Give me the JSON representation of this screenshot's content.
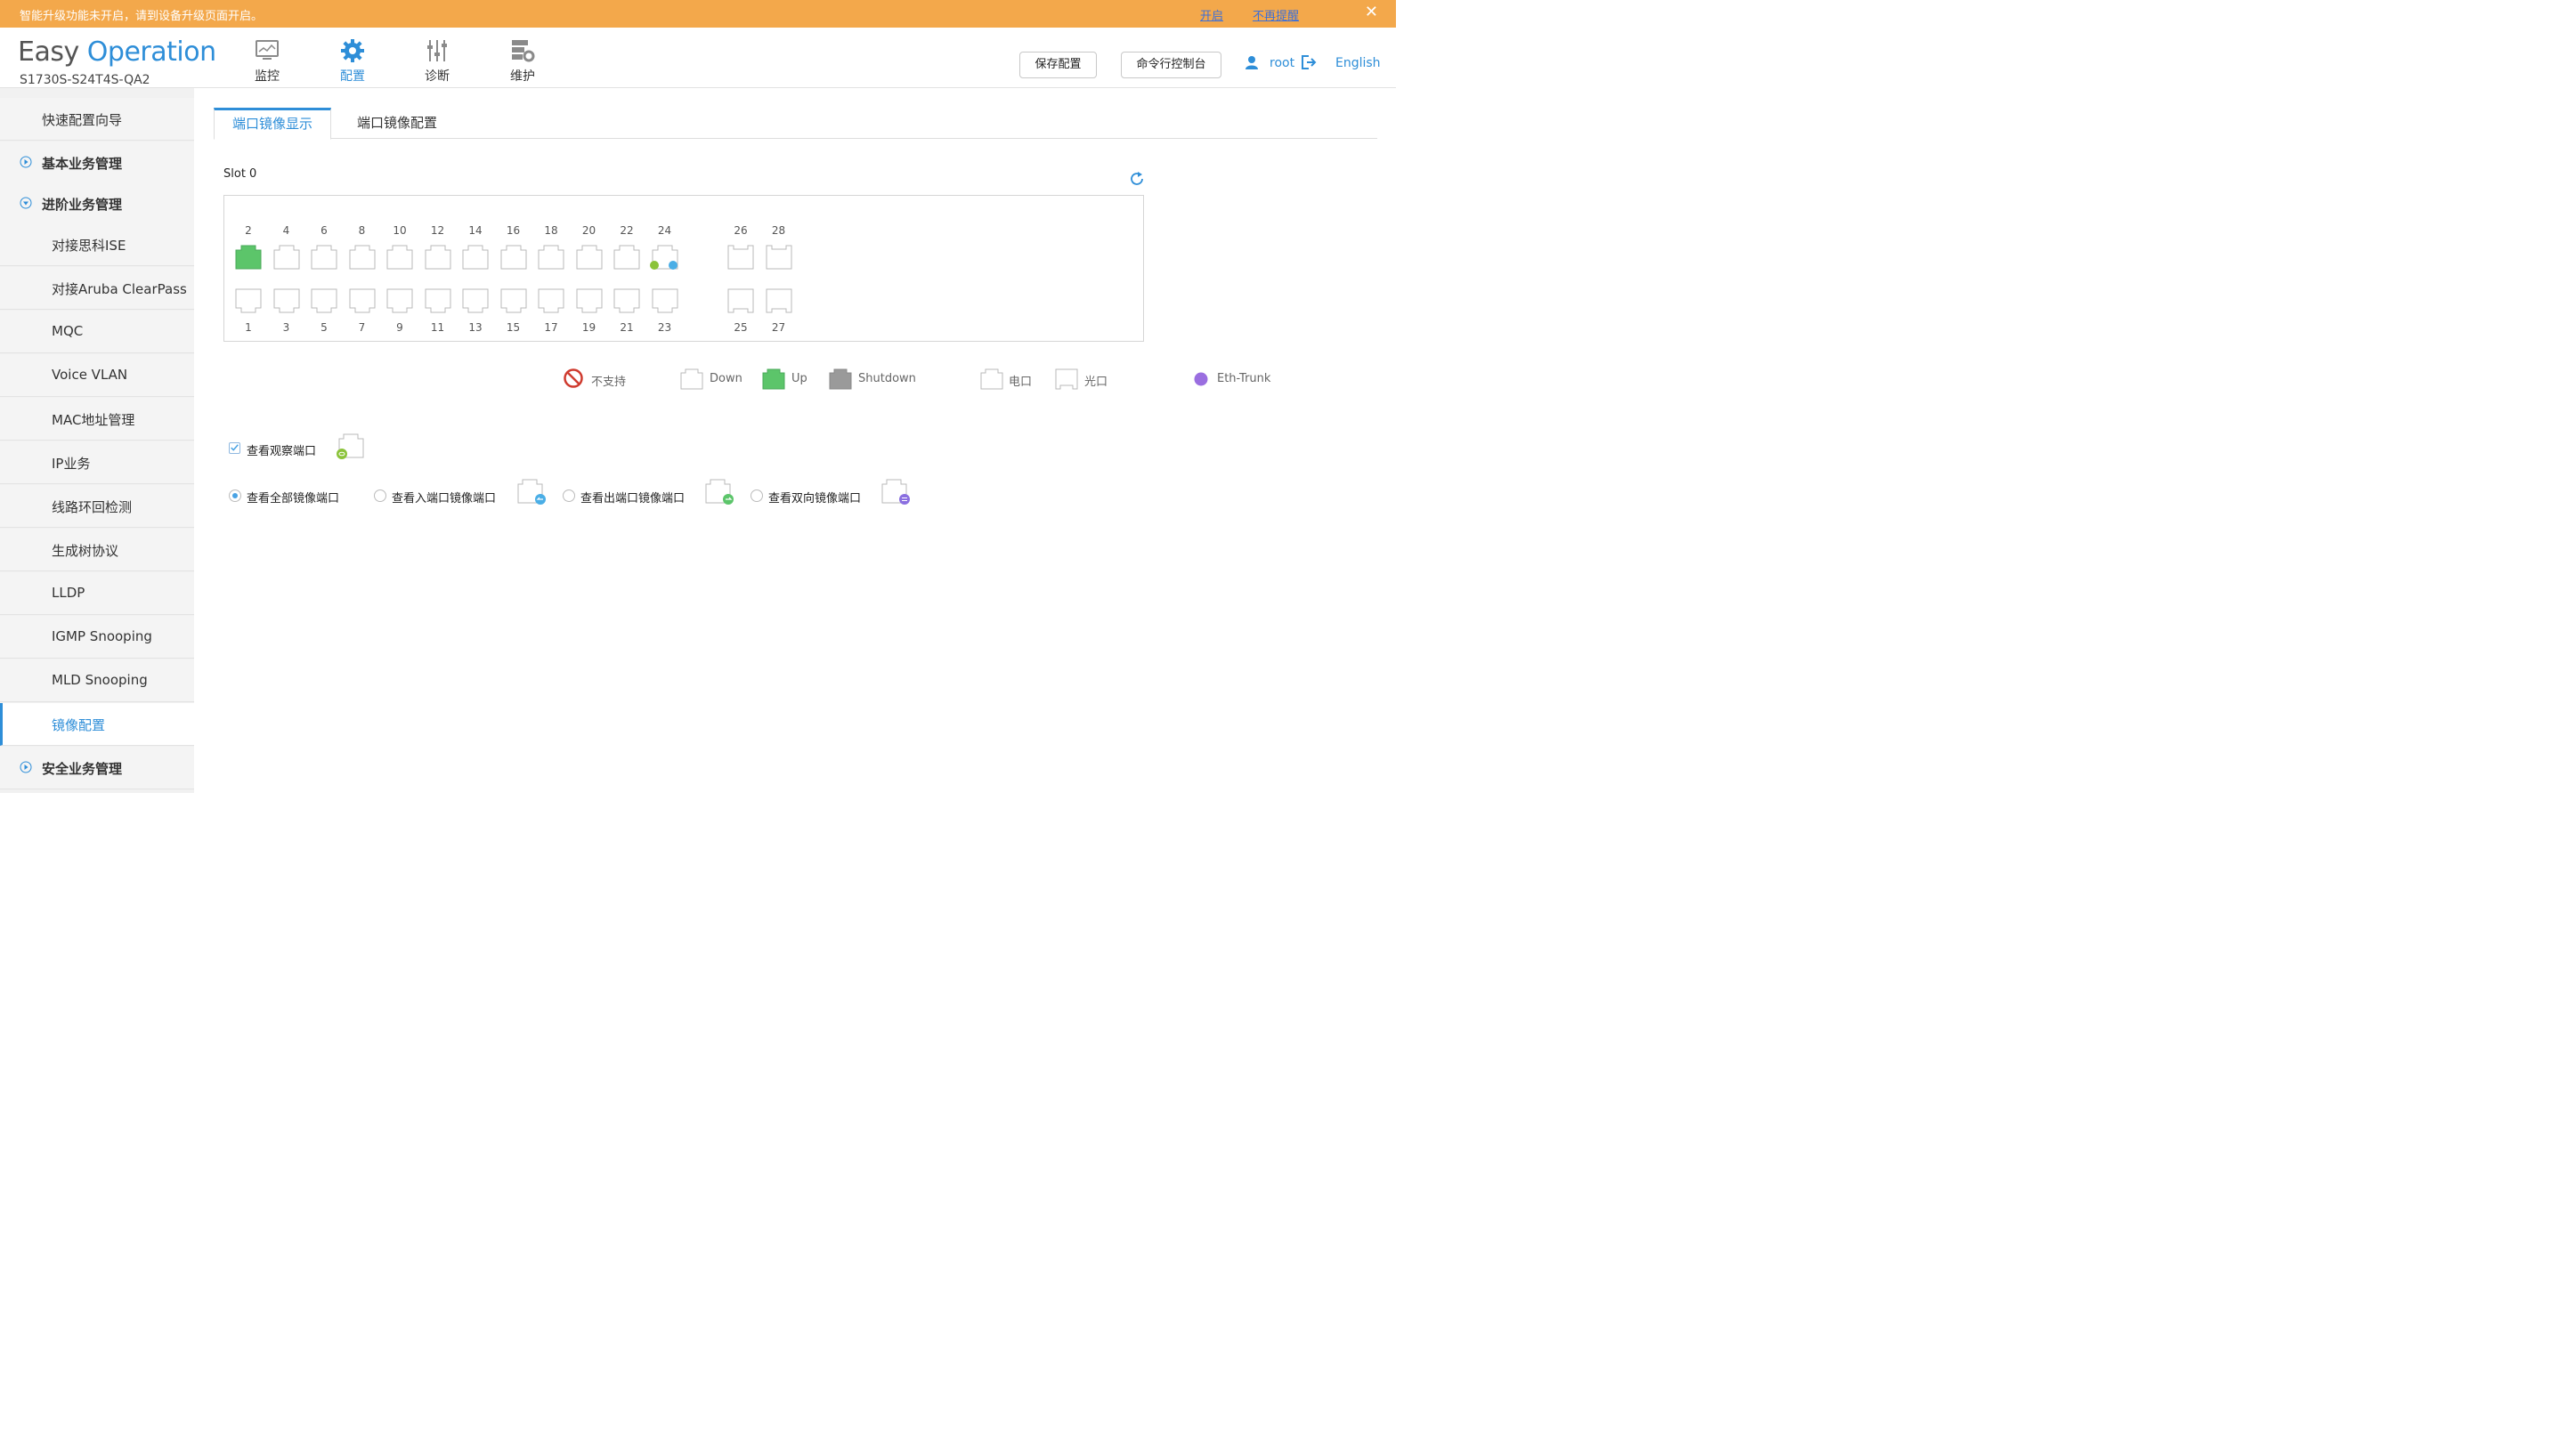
{
  "notice": {
    "message": "智能升级功能未开启，请到设备升级页面开启。",
    "enable_link": "开启",
    "dismiss_link": "不再提醒",
    "close": "✕"
  },
  "brand": {
    "easy": "Easy",
    "operation": "Operation",
    "model": "S1730S-S24T4S-QA2"
  },
  "nav": [
    {
      "label": "监控",
      "icon": "monitor-icon"
    },
    {
      "label": "配置",
      "icon": "gear-icon",
      "active": true
    },
    {
      "label": "诊断",
      "icon": "sliders-icon"
    },
    {
      "label": "维护",
      "icon": "maintenance-icon"
    }
  ],
  "header_actions": {
    "save": "保存配置",
    "cli": "命令行控制台",
    "user": "root",
    "language": "English"
  },
  "sidebar": {
    "quick": "快速配置向导",
    "basic": "基本业务管理",
    "advanced": "进阶业务管理",
    "items": [
      "对接思科ISE",
      "对接Aruba ClearPass",
      "MQC",
      "Voice VLAN",
      "MAC地址管理",
      "IP业务",
      "线路环回检测",
      "生成树协议",
      "LLDP",
      "IGMP Snooping",
      "MLD Snooping",
      "镜像配置"
    ],
    "security": "安全业务管理"
  },
  "tabs": [
    "端口镜像显示",
    "端口镜像配置"
  ],
  "slot_label": "Slot 0",
  "ports": {
    "top": [
      "2",
      "4",
      "6",
      "8",
      "10",
      "12",
      "14",
      "16",
      "18",
      "20",
      "22",
      "24"
    ],
    "bottom": [
      "1",
      "3",
      "5",
      "7",
      "9",
      "11",
      "13",
      "15",
      "17",
      "19",
      "21",
      "23"
    ],
    "fiber_top": [
      "26",
      "28"
    ],
    "fiber_bottom": [
      "25",
      "27"
    ],
    "up_ports": [
      "2"
    ],
    "observe_port": "24",
    "status_colors": {
      "up": "#5cc56a",
      "down": "#ffffff",
      "shutdown": "#9a9a9a",
      "eth_trunk": "#9a6ee0"
    }
  },
  "legend": {
    "unsupported": "不支持",
    "down": "Down",
    "up": "Up",
    "shutdown": "Shutdown",
    "electric": "电口",
    "optical": "光口",
    "eth_trunk": "Eth-Trunk"
  },
  "options": {
    "view_observe": "查看观察端口",
    "view_all": "查看全部镜像端口",
    "view_inbound": "查看入端口镜像端口",
    "view_outbound": "查看出端口镜像端口",
    "view_bidirectional": "查看双向镜像端口",
    "selected": "view_all"
  }
}
